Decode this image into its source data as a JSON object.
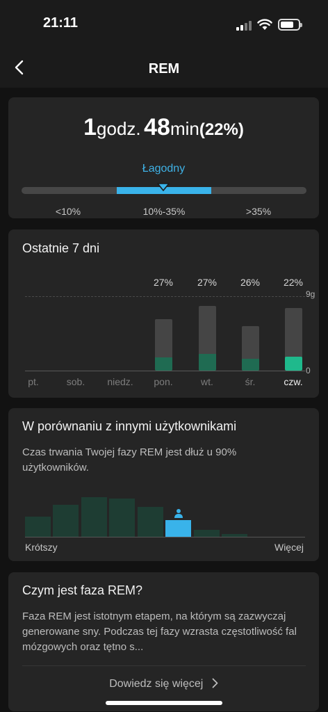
{
  "status_bar": {
    "time": "21:11"
  },
  "nav": {
    "title": "REM"
  },
  "summary": {
    "hours": "1",
    "hours_unit": "godz.",
    "minutes": "48",
    "minutes_unit": "min",
    "percent": "(22%)",
    "level": "Łagodny",
    "range_labels": [
      "<10%",
      "10%-35%",
      ">35%"
    ]
  },
  "last7": {
    "title": "Ostatnie 7 dni",
    "y_axis_labels": [
      "9g",
      "0"
    ]
  },
  "chart_data": {
    "type": "bar",
    "categories": [
      "pt.",
      "sob.",
      "niedz.",
      "pon.",
      "wt.",
      "śr.",
      "czw."
    ],
    "series": [
      {
        "values": [
          null,
          null,
          null,
          6.2,
          7.8,
          5.4,
          7.6
        ]
      },
      {
        "values": [
          null,
          null,
          null,
          1.6,
          2.0,
          1.4,
          1.7
        ]
      }
    ],
    "percent_labels": [
      null,
      null,
      null,
      "27%",
      "27%",
      "26%",
      "22%"
    ],
    "highlighted_category": "czw.",
    "ylim": [
      0,
      9
    ],
    "colors": {
      "total": "#454545",
      "rem": "#1f6b52",
      "rem_current": "#1fb98c"
    }
  },
  "comparison": {
    "title": "W porównaniu z innymi użytkownikami",
    "text": "Czas trwania Twojej fazy REM jest dłuż u 90% użytkowników.",
    "distribution": [
      0.5,
      0.8,
      1.0,
      0.97,
      0.75,
      0.42,
      0.18,
      0.07
    ],
    "user_bin": 5,
    "label_left": "Krótszy",
    "label_right": "Więcej"
  },
  "info": {
    "title": "Czym jest faza REM?",
    "text": "Faza REM jest istotnym etapem, na którym są zazwyczaj generowane sny. Podczas tej fazy wzrasta częstotliwość fal mózgowych oraz tętno s...",
    "learn_more": "Dowiedz się więcej"
  },
  "colors": {
    "accent_blue": "#39b3ea",
    "accent_green": "#1fb98c",
    "card_bg": "#252525",
    "page_bg": "#121212"
  }
}
